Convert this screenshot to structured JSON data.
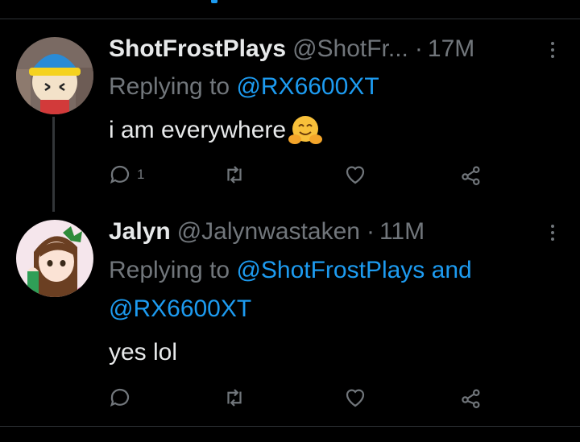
{
  "tweets": [
    {
      "name": "ShotFrostPlays",
      "handle": "@ShotFr...",
      "separator": "·",
      "time": "17M",
      "replying_prefix": "Replying to ",
      "replying_to": [
        "@RX6600XT"
      ],
      "text": "i am everywhere",
      "emoji": "hugging-face",
      "reply_count": "1"
    },
    {
      "name": "Jalyn",
      "handle": "@Jalynwastaken",
      "separator": "·",
      "time": "11M",
      "replying_prefix": "Replying to ",
      "replying_to": [
        "@ShotFrostPlays",
        "@RX6600XT"
      ],
      "replying_joiner": " and",
      "text": "yes lol",
      "reply_count": ""
    }
  ],
  "colors": {
    "background": "#000000",
    "text": "#e7e9ea",
    "muted": "#71767b",
    "accent": "#1d9bf0"
  }
}
